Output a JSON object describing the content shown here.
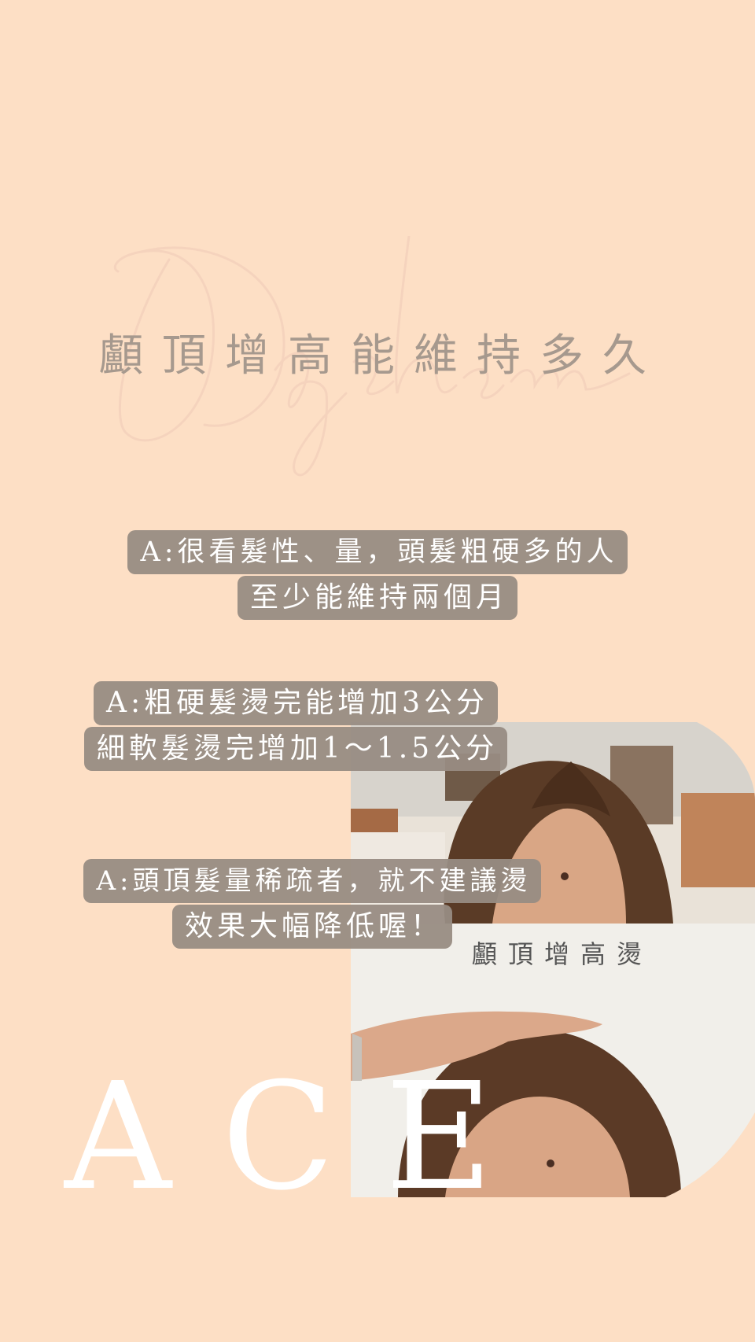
{
  "colors": {
    "background": "#fddfc5",
    "headline": "#a6998e",
    "chip_background": "#988c83",
    "chip_text": "#ffffff",
    "ace_text": "#ffffff"
  },
  "headline": "顱頂增高能維持多久",
  "sections": [
    {
      "lines": [
        "A:很看髮性、量，頭髮粗硬多的人",
        "至少能維持兩個月"
      ]
    },
    {
      "lines": [
        "A:粗硬髮燙完能增加3公分",
        "細軟髮燙完增加1～1.5公分"
      ]
    },
    {
      "lines": [
        "A:頭頂髮量稀疏者，就不建議燙",
        "效果大幅降低喔！"
      ]
    }
  ],
  "photo": {
    "label": "顱頂增高燙",
    "top_alt": "before-photo",
    "bottom_alt": "after-photo"
  },
  "brand": "ACE"
}
